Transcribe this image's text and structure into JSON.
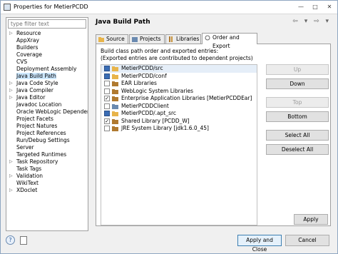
{
  "window": {
    "title": "Properties for MetierPCDD"
  },
  "filter": {
    "placeholder": "type filter text"
  },
  "tree": [
    {
      "label": "Resource",
      "arrow": "▷"
    },
    {
      "label": "AppXray",
      "arrow": ""
    },
    {
      "label": "Builders",
      "arrow": ""
    },
    {
      "label": "Coverage",
      "arrow": ""
    },
    {
      "label": "CVS",
      "arrow": ""
    },
    {
      "label": "Deployment Assembly",
      "arrow": ""
    },
    {
      "label": "Java Build Path",
      "arrow": ""
    },
    {
      "label": "Java Code Style",
      "arrow": "▷"
    },
    {
      "label": "Java Compiler",
      "arrow": "▷"
    },
    {
      "label": "Java Editor",
      "arrow": "▷"
    },
    {
      "label": "Javadoc Location",
      "arrow": ""
    },
    {
      "label": "Oracle WebLogic Dependen",
      "arrow": ""
    },
    {
      "label": "Project Facets",
      "arrow": ""
    },
    {
      "label": "Project Natures",
      "arrow": ""
    },
    {
      "label": "Project References",
      "arrow": ""
    },
    {
      "label": "Run/Debug Settings",
      "arrow": ""
    },
    {
      "label": "Server",
      "arrow": ""
    },
    {
      "label": "Targeted Runtimes",
      "arrow": ""
    },
    {
      "label": "Task Repository",
      "arrow": "▷"
    },
    {
      "label": "Task Tags",
      "arrow": ""
    },
    {
      "label": "Validation",
      "arrow": "▷"
    },
    {
      "label": "WikiText",
      "arrow": ""
    },
    {
      "label": "XDoclet",
      "arrow": "▷"
    }
  ],
  "page": {
    "title": "Java Build Path",
    "nav_arrows": "⇦ ▾ ⇨ ▾"
  },
  "tabs": [
    "Source",
    "Projects",
    "Libraries",
    "Order and Export"
  ],
  "description": {
    "line1": "Build class path order and exported entries:",
    "line2": "(Exported entries are contributed to dependent projects)"
  },
  "entries": [
    {
      "label": "MetierPCDD/src",
      "check": "■"
    },
    {
      "label": "MetierPCDD/conf",
      "check": "■"
    },
    {
      "label": "EAR Libraries",
      "check": ""
    },
    {
      "label": "WebLogic System Libraries",
      "check": ""
    },
    {
      "label": "Enterprise Application Libraries [MetierPCDDEar]",
      "check": "✓"
    },
    {
      "label": "MetierPCDDClient",
      "check": ""
    },
    {
      "label": "MetierPCDD/.apt_src",
      "check": "■"
    },
    {
      "label": "Shared Library [PCDD_W]",
      "check": "✓"
    },
    {
      "label": "JRE System Library [jdk1.6.0_45]",
      "check": ""
    }
  ],
  "buttons": {
    "up": "Up",
    "down": "Down",
    "top": "Top",
    "bottom": "Bottom",
    "select_all": "Select All",
    "deselect_all": "Deselect All",
    "apply": "Apply",
    "apply_close": "Apply and Close",
    "cancel": "Cancel"
  },
  "colors": {
    "selection": "#cde8ff",
    "folder": "#e8b44a",
    "accent": "#3c7fb1"
  }
}
